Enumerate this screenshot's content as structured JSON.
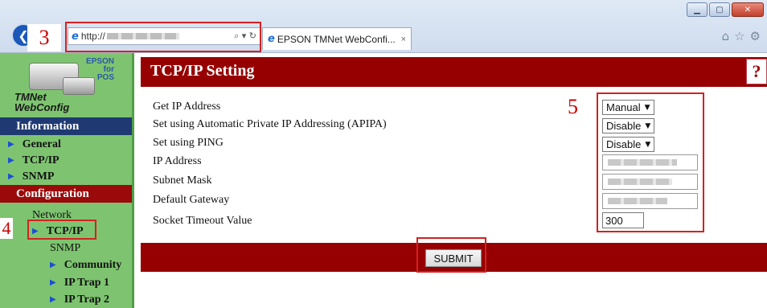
{
  "browser": {
    "address_prefix": "http://",
    "tab_title": "EPSON TMNet WebConfi...",
    "tab_close": "×",
    "address_tools": "⌕ ▾ ↻",
    "back_glyph": "❮",
    "toolbar_icons": [
      "home-icon",
      "star-icon",
      "gear-icon"
    ],
    "window_controls": [
      "minimize",
      "maximize",
      "close"
    ]
  },
  "annotations": {
    "step3": "3",
    "step4": "4",
    "step5": "5"
  },
  "logo": {
    "brand_line1": "EPSON",
    "brand_line2": "for",
    "brand_line3": "POS",
    "product_line1": "TMNet",
    "product_line2": "WebConfig"
  },
  "sidebar": {
    "information": {
      "title": "Information",
      "items": [
        "General",
        "TCP/IP",
        "SNMP"
      ]
    },
    "configuration": {
      "title": "Configuration",
      "network_label": "Network",
      "network_item": "TCP/IP",
      "snmp_label": "SNMP",
      "snmp_items": [
        "Community",
        "IP Trap 1",
        "IP Trap 2"
      ]
    }
  },
  "main": {
    "title": "TCP/IP Setting",
    "help": "?",
    "fields": [
      {
        "label": "Get IP Address",
        "type": "select",
        "value": "Manual"
      },
      {
        "label": "Set using Automatic Private IP Addressing (APIPA)",
        "type": "select",
        "value": "Disable"
      },
      {
        "label": "Set using PING",
        "type": "select",
        "value": "Disable"
      },
      {
        "label": "IP Address",
        "type": "text"
      },
      {
        "label": "Subnet Mask",
        "type": "text"
      },
      {
        "label": "Default Gateway",
        "type": "text"
      },
      {
        "label": "Socket Timeout Value",
        "type": "text",
        "value": "300"
      }
    ],
    "submit_label": "SUBMIT"
  },
  "colors": {
    "header_red": "#960000",
    "sidebar_green": "#7ec470",
    "info_blue": "#1f3a72",
    "annotation_red": "#cc0000"
  }
}
